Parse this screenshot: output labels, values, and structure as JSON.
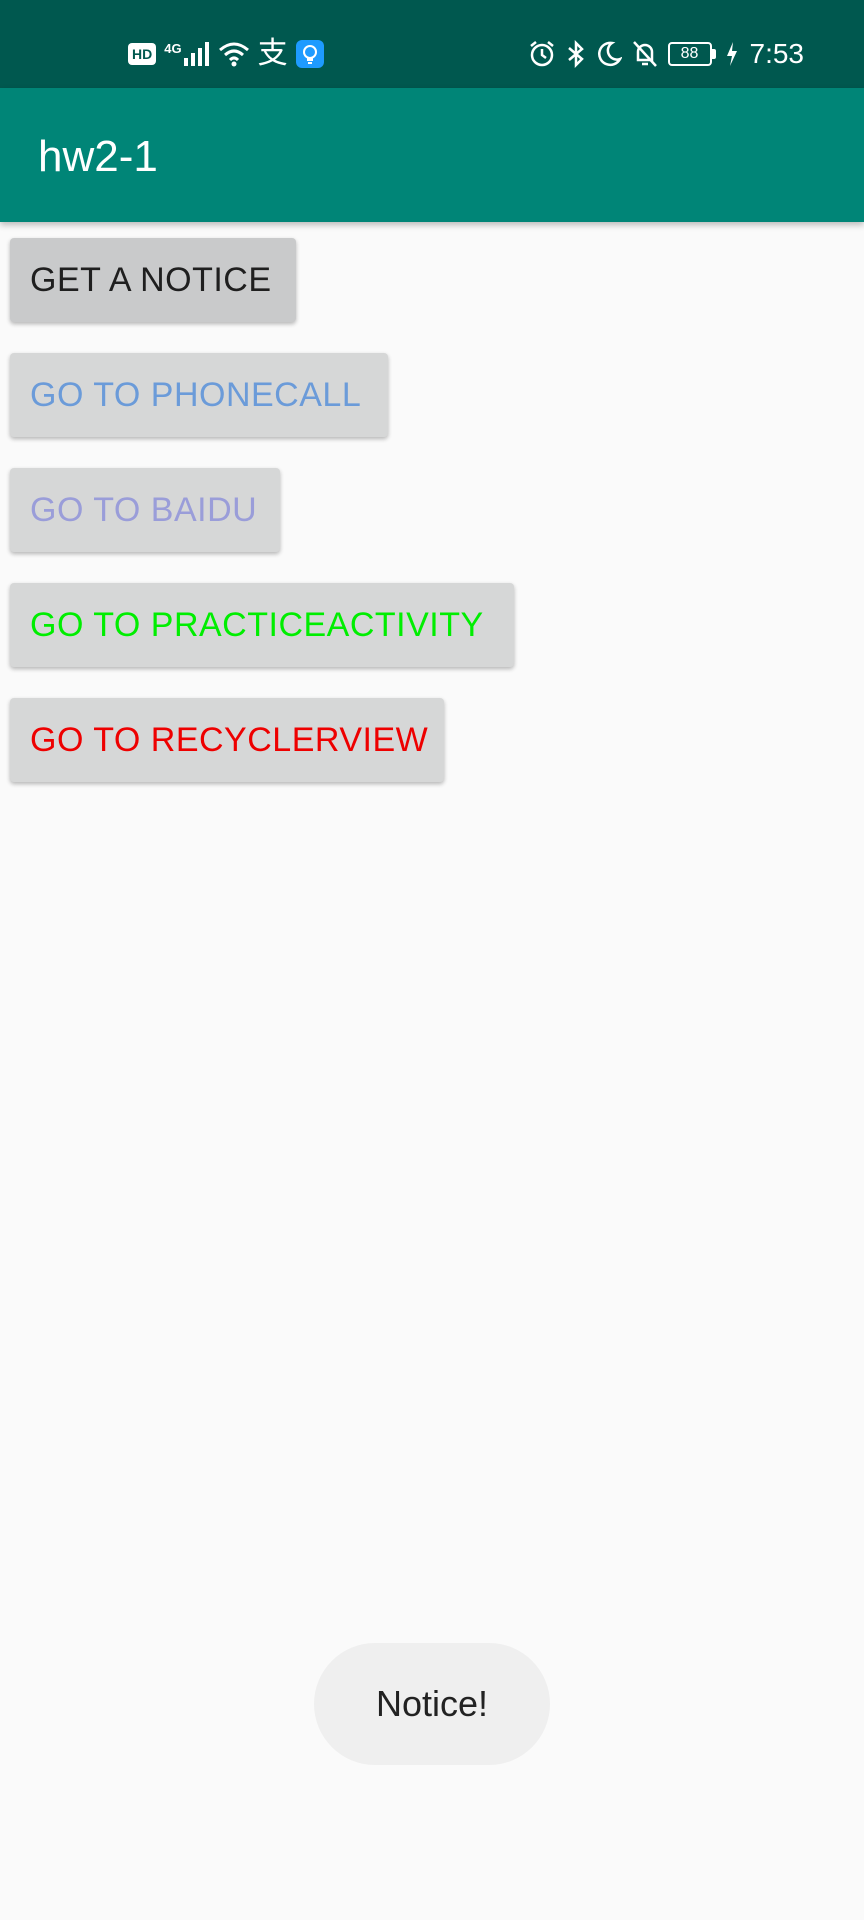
{
  "status_bar": {
    "left_icons": [
      "hd-icon",
      "signal-4g-icon",
      "wifi-icon",
      "alipay-icon",
      "lightbulb-app-icon"
    ],
    "hd_label": "HD",
    "network_label": "4G",
    "alipay_glyph": "支",
    "right_icons": [
      "alarm-icon",
      "bluetooth-icon",
      "moon-icon",
      "bell-off-icon",
      "battery-icon",
      "charging-icon"
    ],
    "battery_level": "88",
    "time": "7:53",
    "background_color": "#00584f"
  },
  "app_bar": {
    "title": "hw2-1",
    "background_color": "#008577"
  },
  "buttons": [
    {
      "label": "GET A NOTICE",
      "color": "#1f1f1f"
    },
    {
      "label": "GO TO PHONECALL",
      "color": "#6b9bd9"
    },
    {
      "label": "GO TO BAIDU",
      "color": "#9a9dd9"
    },
    {
      "label": "GO TO PRACTICEACTIVITY",
      "color": "#00ee00"
    },
    {
      "label": "GO TO RECYCLERVIEW",
      "color": "#ee0000"
    }
  ],
  "toast": {
    "message": "Notice!"
  }
}
